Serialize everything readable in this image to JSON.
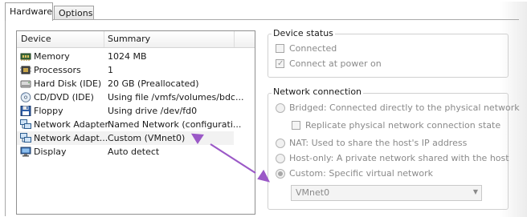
{
  "tabs": [
    {
      "label": "Hardware",
      "active": true
    },
    {
      "label": "Options",
      "active": false
    }
  ],
  "device_list": {
    "columns": [
      "Device",
      "Summary"
    ],
    "rows": [
      {
        "icon": "memory-icon",
        "device": "Memory",
        "summary": "1024 MB"
      },
      {
        "icon": "processor-icon",
        "device": "Processors",
        "summary": "1"
      },
      {
        "icon": "hard-disk-icon",
        "device": "Hard Disk (IDE)",
        "summary": "20 GB (Preallocated)"
      },
      {
        "icon": "cd-dvd-icon",
        "device": "CD/DVD (IDE)",
        "summary": "Using file /vmfs/volumes/bdc..."
      },
      {
        "icon": "floppy-icon",
        "device": "Floppy",
        "summary": "Using drive /dev/fd0"
      },
      {
        "icon": "network-adapter-icon",
        "device": "Network Adapter",
        "summary": "Named Network (configurati..."
      },
      {
        "icon": "network-adapter-icon",
        "device": "Network Adapt...",
        "summary": "Custom (VMnet0)",
        "selected": true
      },
      {
        "icon": "display-icon",
        "device": "Display",
        "summary": "Auto detect"
      }
    ]
  },
  "device_status": {
    "title": "Device status",
    "connected": {
      "label": "Connected",
      "checked": false
    },
    "connect_at_power_on": {
      "label": "Connect at power on",
      "checked": true
    }
  },
  "network_connection": {
    "title": "Network connection",
    "bridged": "Bridged: Connected directly to the physical network",
    "replicate": "Replicate physical network connection state",
    "nat": "NAT: Used to share the host's IP address",
    "host_only": "Host-only: A private network shared with the host",
    "custom": "Custom: Specific virtual network",
    "selected_option": "custom",
    "vmnet_value": "VMnet0"
  },
  "colors": {
    "annotation_arrow": "#9b59c7",
    "selection_bg": "#f2f2f2",
    "disabled_text": "#8a8a8a"
  }
}
